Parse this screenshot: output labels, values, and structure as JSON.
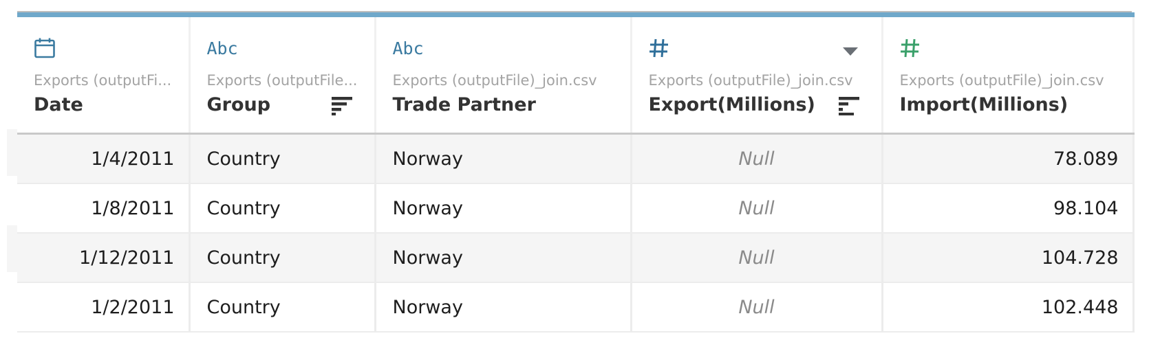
{
  "columns": [
    {
      "type_icon": "calendar-icon",
      "source": "Exports (outputFi...",
      "name": "Date",
      "sorted": false
    },
    {
      "type_icon": "abc",
      "type_text": "Abc",
      "source": "Exports (outputFile...",
      "name": "Group",
      "sorted": true
    },
    {
      "type_icon": "abc",
      "type_text": "Abc",
      "source": "Exports (outputFile)_join.csv",
      "name": "Trade Partner",
      "sorted": false
    },
    {
      "type_icon": "number-icon",
      "source": "Exports (outputFile)_join.csv",
      "name": "Export(Millions)",
      "sorted": true,
      "menu_open": true
    },
    {
      "type_icon": "number-icon",
      "source": "Exports (outputFile)_join.csv",
      "name": "Import(Millions)",
      "sorted": false
    }
  ],
  "rows": [
    {
      "date": "1/4/2011",
      "group": "Country",
      "trade_partner": "Norway",
      "export": "Null",
      "import": "78.089"
    },
    {
      "date": "1/8/2011",
      "group": "Country",
      "trade_partner": "Norway",
      "export": "Null",
      "import": "98.104"
    },
    {
      "date": "1/12/2011",
      "group": "Country",
      "trade_partner": "Norway",
      "export": "Null",
      "import": "104.728"
    },
    {
      "date": "1/2/2011",
      "group": "Country",
      "trade_partner": "Norway",
      "export": "Null",
      "import": "102.448"
    }
  ],
  "colors": {
    "header_accent": "#6fa8ca",
    "date_icon": "#3a7aa0",
    "string_icon": "#3a7aa0",
    "export_number_icon": "#2f6f9a",
    "import_number_icon": "#3aa06a",
    "null_text": "#8a8a8a"
  }
}
